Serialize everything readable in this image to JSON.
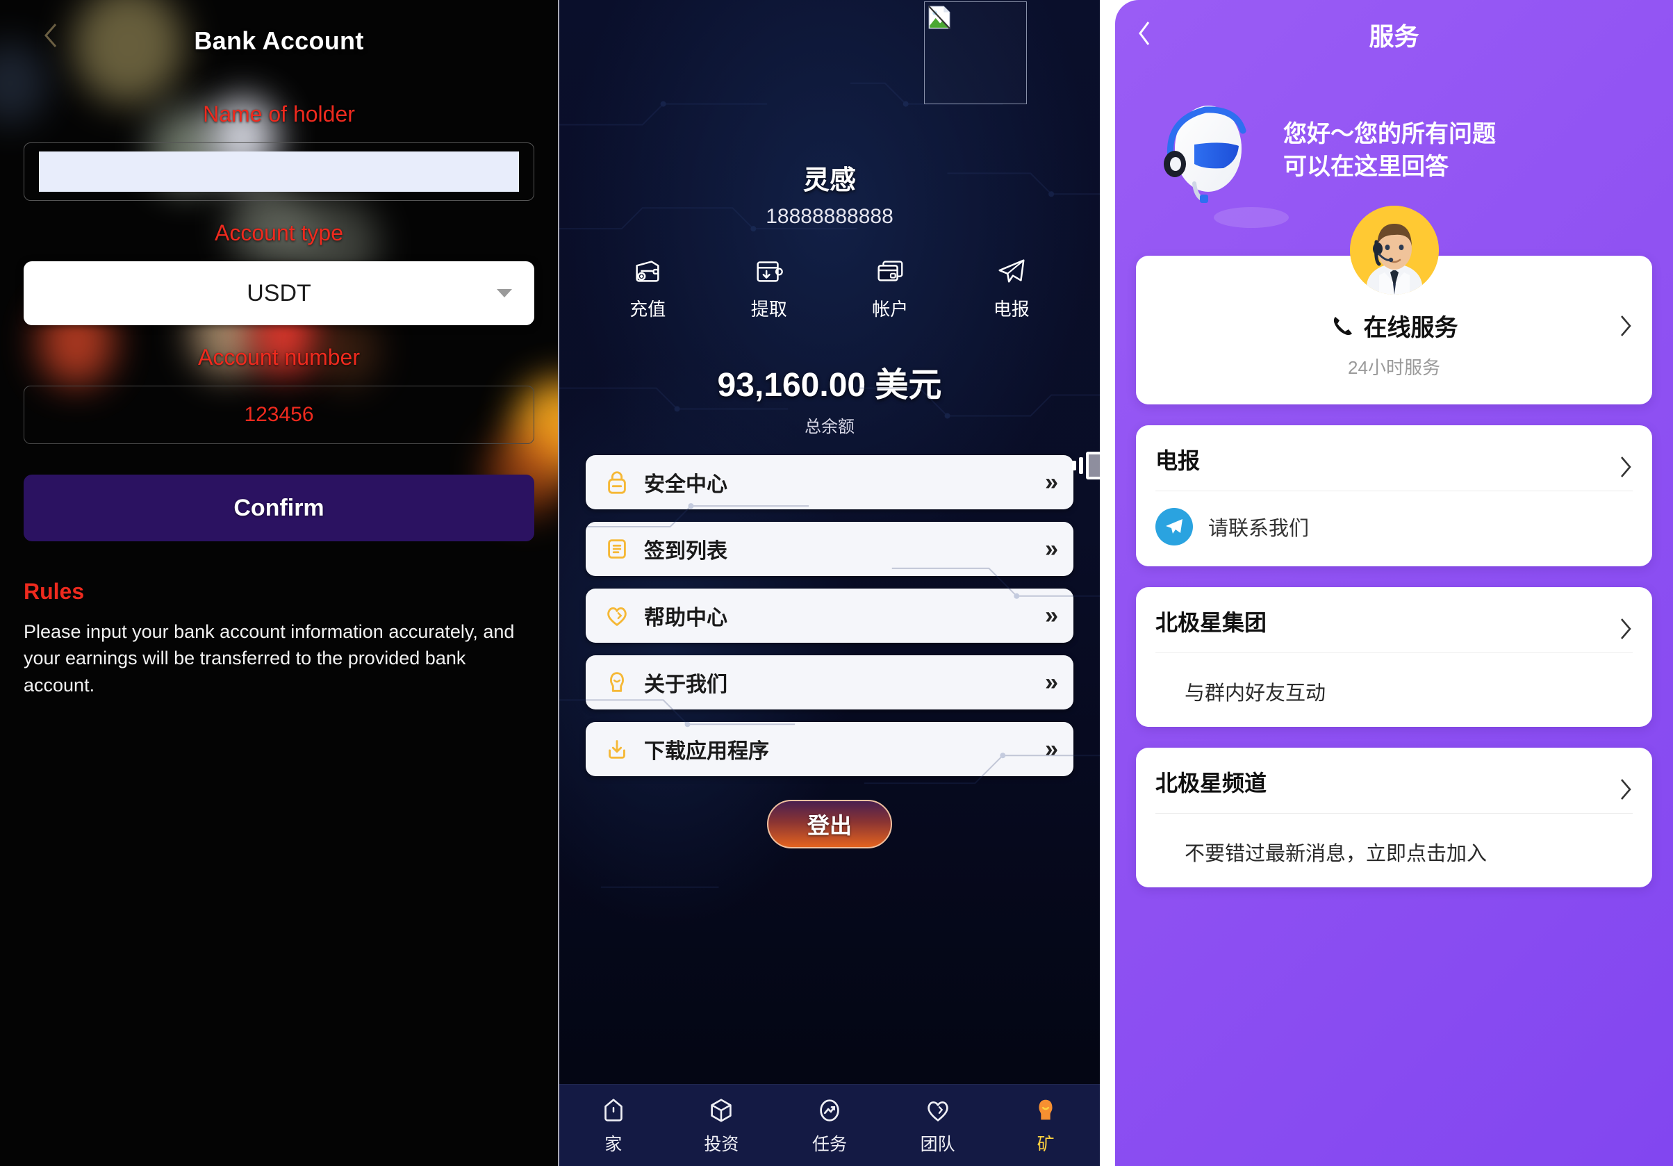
{
  "panel1": {
    "back_icon": "chevron-left-icon",
    "title": "Bank Account",
    "name_label": "Name of holder",
    "name_value": "",
    "name_placeholder": "",
    "account_type_label": "Account type",
    "account_type_value": "USDT",
    "caret_icon": "chevron-down-icon",
    "account_number_label": "Account number",
    "account_number_value": "123456",
    "confirm_label": "Confirm",
    "rules_title": "Rules",
    "rules_body": "Please input your bank account information accurately, and your earnings will be transferred to the provided bank account.",
    "colors": {
      "label_red": "#ee2a1e",
      "confirm_bg": "#2b1261",
      "background": "#040404"
    }
  },
  "panel2": {
    "broken_image_icon": "broken-image-icon",
    "user_name": "灵感",
    "user_phone": "18888888888",
    "actions": [
      {
        "icon": "wallet-recharge-icon",
        "label": "充值"
      },
      {
        "icon": "wallet-withdraw-icon",
        "label": "提取"
      },
      {
        "icon": "bank-card-icon",
        "label": "帐户"
      },
      {
        "icon": "telegram-plane-icon",
        "label": "电报"
      }
    ],
    "balance": "93,160.00 美元",
    "balance_label": "总余额",
    "menu": [
      {
        "icon": "lock-icon",
        "label": "安全中心",
        "arrow": "»"
      },
      {
        "icon": "list-document-icon",
        "label": "签到列表",
        "arrow": "»"
      },
      {
        "icon": "heart-help-icon",
        "label": "帮助中心",
        "arrow": "»"
      },
      {
        "icon": "person-about-icon",
        "label": "关于我们",
        "arrow": "»"
      },
      {
        "icon": "download-icon",
        "label": "下载应用程序",
        "arrow": "»"
      }
    ],
    "logout_label": "登出",
    "float_widget_icon": "sound-volume-icon",
    "bottom_nav": [
      {
        "icon": "home-icon",
        "label": "家",
        "active": false
      },
      {
        "icon": "cube-invest-icon",
        "label": "投资",
        "active": false
      },
      {
        "icon": "task-trend-icon",
        "label": "任务",
        "active": false
      },
      {
        "icon": "team-heart-icon",
        "label": "团队",
        "active": false
      },
      {
        "icon": "miner-person-icon",
        "label": "矿",
        "active": true
      }
    ],
    "colors": {
      "background": "#0a0f2b",
      "icon_yellow": "#f5b836",
      "nav_active": "#ffd23f"
    }
  },
  "panel3": {
    "back_icon": "chevron-left-icon",
    "title": "服务",
    "robot_icon": "headset-robot-icon",
    "hero_line1": "您好～您的所有问题",
    "hero_line2": "可以在这里回答",
    "avatar_icon": "support-agent-avatar",
    "service": {
      "phone_icon": "phone-icon",
      "title": "在线服务",
      "subtitle": "24小时服务",
      "chevron": "›"
    },
    "links": [
      {
        "title": "电报",
        "chevron": "›",
        "icon": "telegram-circle-icon",
        "desc": "请联系我们",
        "indent": false
      },
      {
        "title": "北极星集团",
        "chevron": "›",
        "icon": "",
        "desc": "与群内好友互动",
        "indent": true
      },
      {
        "title": "北极星频道",
        "chevron": "›",
        "icon": "",
        "desc": "不要错过最新消息，立即点击加入",
        "indent": true
      }
    ],
    "colors": {
      "background_purple": "#8f51f2",
      "avatar_bg": "#ffc933",
      "telegram_blue": "#2aa3e0"
    }
  }
}
